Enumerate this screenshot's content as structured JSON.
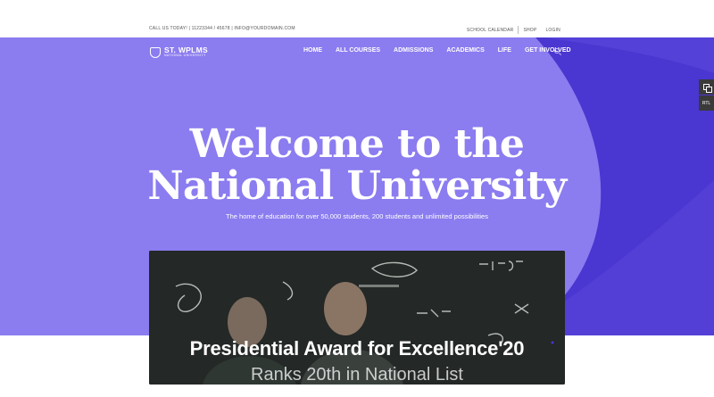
{
  "topbar": {
    "contact": "CALL US TODAY! | 11223344 / 45678 | INFO@YOURDOMAIN.COM",
    "links": [
      "SCHOOL CALENDAR",
      "SHOP",
      "LOGIN"
    ]
  },
  "logo": {
    "name": "ST. WPLMS",
    "subtitle": "NATIONAL UNIVERSITY"
  },
  "nav": {
    "items": [
      "HOME",
      "ALL COURSES",
      "ADMISSIONS",
      "ACADEMICS",
      "LIFE",
      "GET INVOLVED"
    ],
    "search_icon": "search-icon"
  },
  "hero": {
    "title_line1": "Welcome to the",
    "title_line2": "National University",
    "subtitle": "The home of education for over 50,000 students, 200 students and unlimited possibilities"
  },
  "video": {
    "title": "Presidential Award for Excellence'20",
    "subtitle": "Ranks 20th in National List"
  },
  "side_tools": {
    "rtl_label": "RTL"
  },
  "colors": {
    "hero_dark": "#4a36d0",
    "hero_light": "#8b7cf0",
    "accent_white": "#ffffff"
  }
}
